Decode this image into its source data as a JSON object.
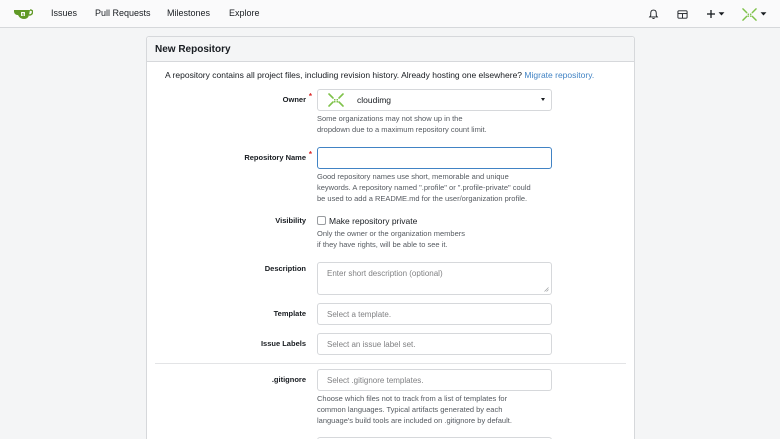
{
  "nav": {
    "items": [
      "Issues",
      "Pull Requests",
      "Milestones",
      "Explore"
    ],
    "icons": [
      "bell-icon",
      "board-icon",
      "plus-icon",
      "avatar-icon"
    ]
  },
  "form": {
    "title": "New Repository",
    "intro_text": "A repository contains all project files, including revision history. Already hosting one elsewhere?",
    "migrate_link": "Migrate repository.",
    "owner": {
      "label": "Owner",
      "value": "cloudimg",
      "help": [
        "Some organizations may not show up in the",
        "dropdown due to a maximum repository count limit."
      ]
    },
    "repo_name": {
      "label": "Repository Name",
      "value": "",
      "help": [
        "Good repository names use short, memorable and unique",
        "keywords. A repository named \".profile\" or \".profile-private\" could",
        "be used to add a README.md for the user/organization profile."
      ]
    },
    "visibility": {
      "label": "Visibility",
      "checkbox_label": "Make repository private",
      "checked": false,
      "help": [
        "Only the owner or the organization members",
        "if they have rights, will be able to see it."
      ]
    },
    "description": {
      "label": "Description",
      "placeholder": "Enter short description (optional)"
    },
    "template": {
      "label": "Template",
      "placeholder": "Select a template."
    },
    "issue_labels": {
      "label": "Issue Labels",
      "placeholder": "Select an issue label set."
    },
    "gitignore": {
      "label": ".gitignore",
      "placeholder": "Select .gitignore templates.",
      "help": [
        "Choose which files not to track from a list of templates for",
        "common languages. Typical artifacts generated by each",
        "language's build tools are included on .gitignore by default."
      ]
    }
  },
  "colors": {
    "accent": "#4183c4",
    "logo": "#609926",
    "required": "#db2828"
  }
}
